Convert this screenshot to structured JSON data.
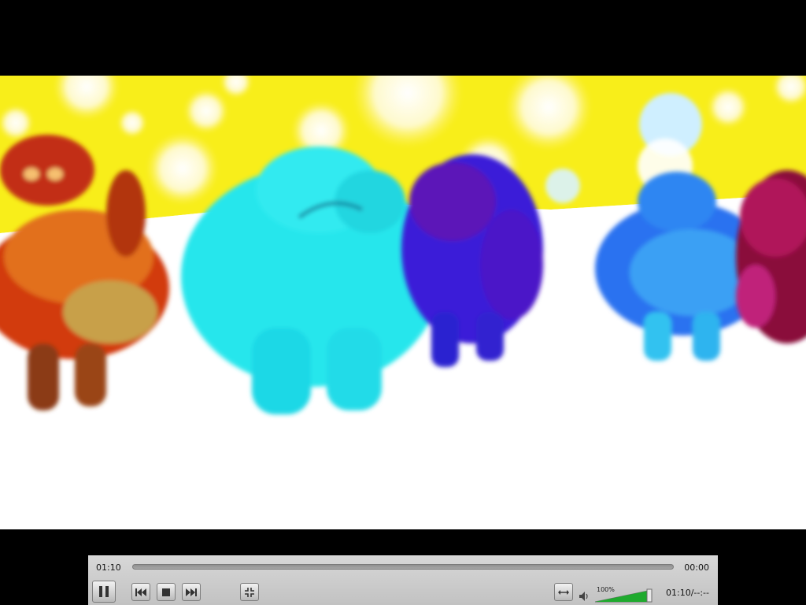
{
  "player": {
    "elapsed_time": "01:10",
    "remaining_time": "00:00",
    "time_display": "01:10/--:--",
    "volume_label": "100%",
    "volume_level": 1.0,
    "seek_progress": 0.0,
    "state": "playing"
  },
  "icons": {
    "pause": "pause-icon",
    "previous": "skip-back-icon",
    "stop": "stop-icon",
    "next": "skip-forward-icon",
    "fullscreen": "fullscreen-icon",
    "aspect": "stretch-icon",
    "volume": "speaker-icon"
  },
  "colors": {
    "volume_fill": "#1faa2e",
    "control_bar": "#cfcfcf"
  }
}
